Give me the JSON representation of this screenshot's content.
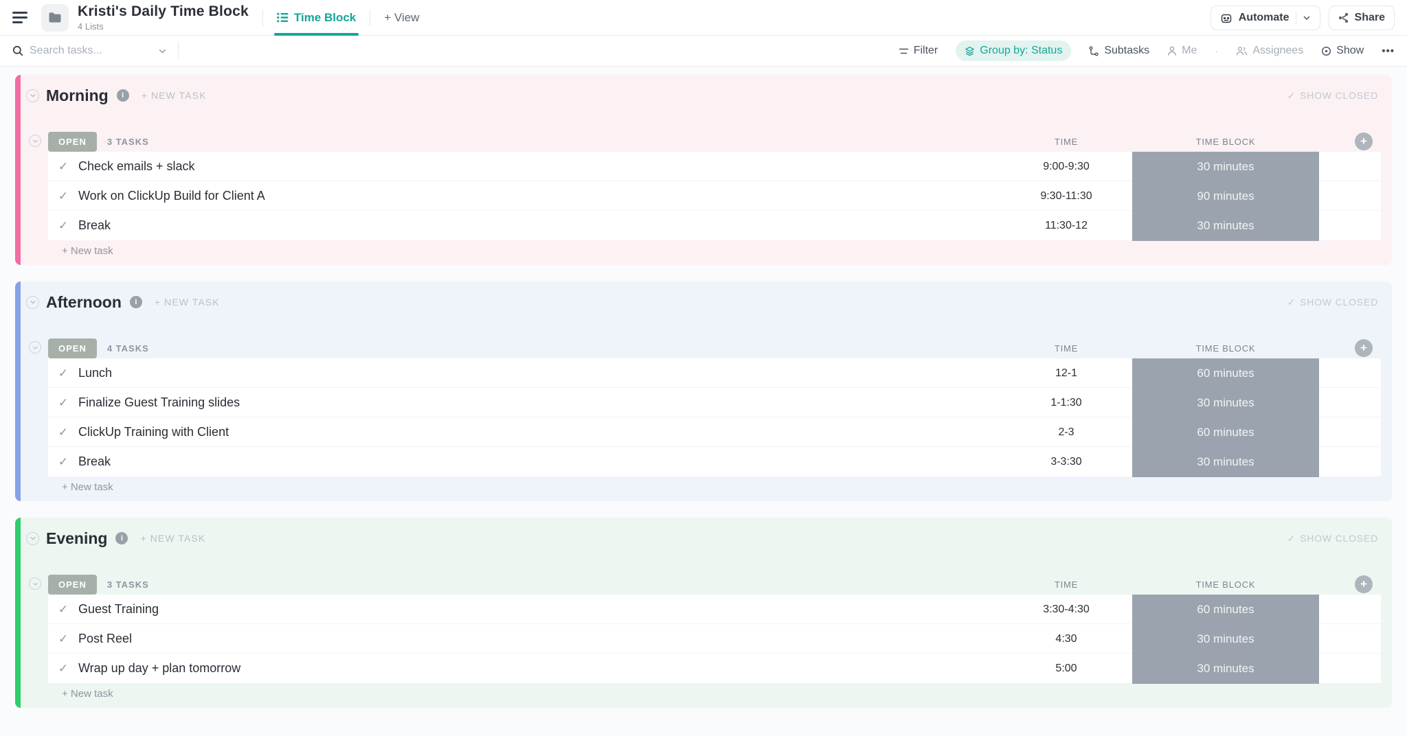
{
  "header": {
    "title": "Kristi's Daily Time Block",
    "subtitle": "4 Lists",
    "tab_active": "Time Block",
    "tab_add_view": "+ View",
    "automate_label": "Automate",
    "share_label": "Share"
  },
  "toolbar": {
    "search_placeholder": "Search tasks...",
    "filter_label": "Filter",
    "group_by_label": "Group by: Status",
    "subtasks_label": "Subtasks",
    "me_label": "Me",
    "assignees_label": "Assignees",
    "show_label": "Show",
    "more_label": "•••"
  },
  "labels": {
    "new_task_upper": "+ NEW TASK",
    "show_closed": "SHOW CLOSED",
    "time_col": "TIME",
    "time_block_col": "TIME BLOCK",
    "new_task": "+ New task"
  },
  "icons": {
    "check": "✓",
    "plus": "+",
    "info": "i",
    "dot_sep": "·"
  },
  "colors": {
    "accent_teal": "#14a796",
    "morning_accent": "#f06ea2",
    "afternoon_accent": "#86a2e6",
    "evening_accent": "#2fcd6e",
    "open_badge": "#a6b0a8",
    "time_block_fill": "#9ba4ae"
  },
  "sections": [
    {
      "name": "Morning",
      "status": "OPEN",
      "task_count": "3 TASKS",
      "accent": "#f06ea2",
      "tint": "#fcf1f3",
      "tasks": [
        {
          "name": "Check emails + slack",
          "time": "9:00-9:30",
          "block": "30 minutes"
        },
        {
          "name": "Work on ClickUp Build for Client A",
          "time": "9:30-11:30",
          "block": "90 minutes"
        },
        {
          "name": "Break",
          "time": "11:30-12",
          "block": "30 minutes"
        }
      ]
    },
    {
      "name": "Afternoon",
      "status": "OPEN",
      "task_count": "4 TASKS",
      "accent": "#86a2e6",
      "tint": "#eff4fa",
      "tasks": [
        {
          "name": "Lunch",
          "time": "12-1",
          "block": "60 minutes"
        },
        {
          "name": "Finalize Guest Training slides",
          "time": "1-1:30",
          "block": "30 minutes"
        },
        {
          "name": "ClickUp Training with Client",
          "time": "2-3",
          "block": "60 minutes"
        },
        {
          "name": "Break",
          "time": "3-3:30",
          "block": "30 minutes"
        }
      ]
    },
    {
      "name": "Evening",
      "status": "OPEN",
      "task_count": "3 TASKS",
      "accent": "#2fcd6e",
      "tint": "#edf6f0",
      "tasks": [
        {
          "name": "Guest Training",
          "time": "3:30-4:30",
          "block": "60 minutes"
        },
        {
          "name": "Post Reel",
          "time": "4:30",
          "block": "30 minutes"
        },
        {
          "name": "Wrap up day + plan tomorrow",
          "time": "5:00",
          "block": "30 minutes"
        }
      ]
    }
  ]
}
